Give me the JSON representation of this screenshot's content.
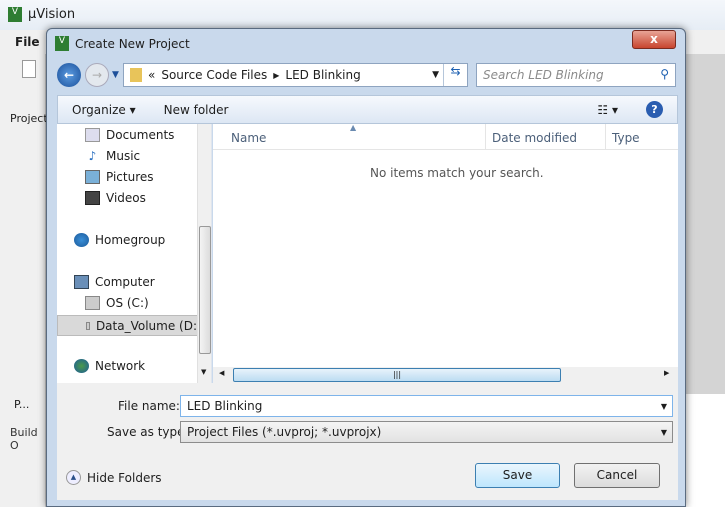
{
  "app": {
    "title": "μVision",
    "menu_file": "File",
    "project_tab": "Project",
    "bottom_tab": "P...",
    "build_label": "Build O"
  },
  "dialog": {
    "title": "Create New Project",
    "close": "x",
    "breadcrumb": [
      "«",
      "Source Code Files",
      "LED Blinking"
    ],
    "search_placeholder": "Search LED Blinking",
    "toolbar": {
      "organize": "Organize ▾",
      "new_folder": "New folder",
      "view": "☷ ▾",
      "help": "?"
    },
    "nav": [
      {
        "label": "Documents",
        "icon": "documents-icon"
      },
      {
        "label": "Music",
        "icon": "music-icon"
      },
      {
        "label": "Pictures",
        "icon": "pictures-icon"
      },
      {
        "label": "Videos",
        "icon": "videos-icon"
      },
      {
        "label": "Homegroup",
        "icon": "homegroup-icon"
      },
      {
        "label": "Computer",
        "icon": "computer-icon"
      },
      {
        "label": "OS (C:)",
        "icon": "drive-icon"
      },
      {
        "label": "Data_Volume (D:",
        "icon": "drive-icon",
        "selected": true
      },
      {
        "label": "Network",
        "icon": "network-icon"
      }
    ],
    "columns": [
      "Name",
      "Date modified",
      "Type"
    ],
    "empty_message": "No items match your search.",
    "file_name_label": "File name:",
    "file_name": "LED Blinking",
    "save_type_label": "Save as type:",
    "save_type": "Project Files (*.uvproj; *.uvprojx)",
    "hide_folders": "Hide Folders",
    "save": "Save",
    "cancel": "Cancel"
  }
}
